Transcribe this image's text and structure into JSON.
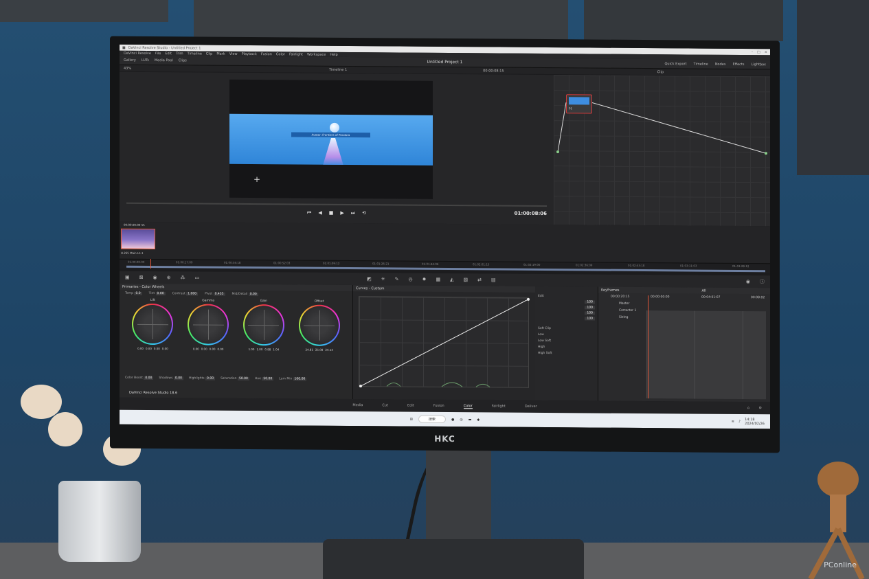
{
  "app": {
    "window_title": "DaVinci Resolve Studio - Untitled Project 1",
    "project_title": "Untitled Project 1",
    "menu": [
      "DaVinci Resolve",
      "File",
      "Edit",
      "Trim",
      "Timeline",
      "Clip",
      "Mark",
      "View",
      "Playback",
      "Fusion",
      "Color",
      "Fairlight",
      "Workspace",
      "Help"
    ],
    "toolbar_left": [
      "Gallery",
      "LUTs",
      "Media Pool",
      "Clips"
    ],
    "toolbar_right": [
      "Quick Export",
      "Timeline",
      "Nodes",
      "Effects",
      "Lightbox"
    ],
    "zoom": "43%",
    "timeline_name": "Timeline 1",
    "viewer_timecode_top": "00:00:08:15",
    "node_mode": "Clip",
    "viewer_timecode": "01:00:08:06",
    "video_caption": "Avatar: Frontiers of Pandora",
    "clip_tc": "00:00:00:00",
    "clip_track": "V1",
    "clip_codec": "H.265 Main L5.1",
    "node_label": "01"
  },
  "ruler_ticks": [
    "01:00:00:00",
    "01:00:17:09",
    "01:00:34:18",
    "01:00:52:03",
    "01:01:09:12",
    "01:01:26:21",
    "01:01:44:06",
    "01:02:01:15",
    "01:02:19:00",
    "01:02:36:09",
    "01:02:53:18",
    "01:03:11:03",
    "01:03:28:12"
  ],
  "primaries": {
    "title": "Primaries - Color Wheels",
    "top_params": [
      {
        "label": "Temp",
        "value": "0.0"
      },
      {
        "label": "Tint",
        "value": "0.00"
      },
      {
        "label": "Contrast",
        "value": "1.000"
      },
      {
        "label": "Pivot",
        "value": "0.435"
      },
      {
        "label": "Mid/Detail",
        "value": "0.00"
      }
    ],
    "wheels": [
      {
        "name": "Lift",
        "values": [
          "0.00",
          "0.00",
          "0.00",
          "0.00"
        ]
      },
      {
        "name": "Gamma",
        "values": [
          "0.00",
          "0.00",
          "0.00",
          "0.00"
        ]
      },
      {
        "name": "Gain",
        "values": [
          "1.00",
          "1.00",
          "0.88",
          "1.04"
        ]
      },
      {
        "name": "Offset",
        "values": [
          "24.81",
          "25.08",
          "24.13"
        ]
      }
    ],
    "bottom_params": [
      {
        "label": "Color Boost",
        "value": "0.00"
      },
      {
        "label": "Shadows",
        "value": "0.00"
      },
      {
        "label": "Highlights",
        "value": "0.00"
      },
      {
        "label": "Saturation",
        "value": "50.00"
      },
      {
        "label": "Hue",
        "value": "50.00"
      },
      {
        "label": "Lum Mix",
        "value": "100.00"
      }
    ],
    "product": "DaVinci Resolve Studio 18.6"
  },
  "curves": {
    "title": "Curves - Custom"
  },
  "edit": {
    "label": "Edit",
    "values": [
      "100",
      "100",
      "100",
      "100"
    ],
    "soft_clip": "Soft Clip",
    "soft_items": [
      "Low",
      "Low Soft",
      "High",
      "High Soft"
    ]
  },
  "keyframes": {
    "title": "Keyframes",
    "filter": "All",
    "tc": "00:00:20:15",
    "ruler": [
      "00:00:00:00",
      "00:04:01:07",
      "00:08:02"
    ],
    "tracks": [
      "Master",
      "Corrector 1",
      "Sizing"
    ]
  },
  "pages": [
    "Media",
    "Cut",
    "Edit",
    "Fusion",
    "Color",
    "Fairlight",
    "Deliver"
  ],
  "active_page": "Color",
  "taskbar": {
    "search": "搜索",
    "time": "14:18",
    "date": "2024/02/26"
  },
  "monitor_brand": "HKC",
  "watermark": "PConline",
  "colors": {
    "accent": "#e3573a",
    "wall": "#1f4a6e"
  }
}
